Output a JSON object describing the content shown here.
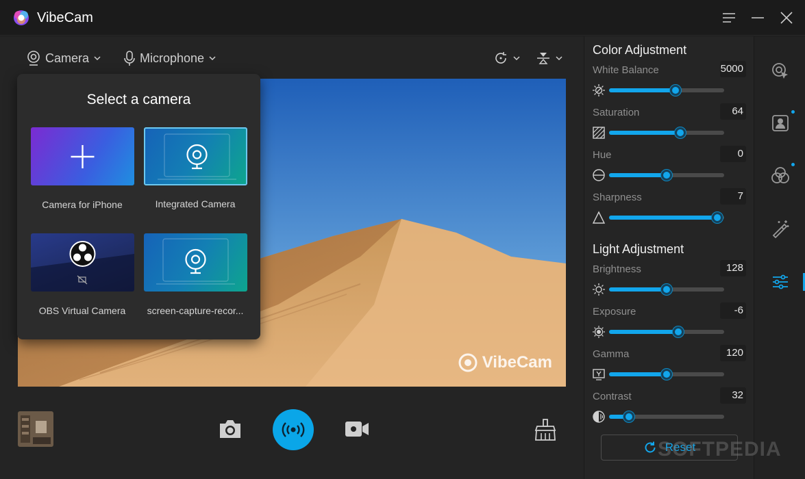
{
  "app": {
    "title": "VibeCam"
  },
  "toolbar": {
    "camera_label": "Camera",
    "microphone_label": "Microphone"
  },
  "popup": {
    "title": "Select a camera",
    "cameras": [
      {
        "label": "Camera for iPhone"
      },
      {
        "label": "Integrated Camera"
      },
      {
        "label": "OBS Virtual Camera"
      },
      {
        "label": "screen-capture-recor..."
      }
    ]
  },
  "preview": {
    "watermark": "VibeCam"
  },
  "color_adjustment": {
    "title": "Color Adjustment",
    "items": [
      {
        "label": "White Balance",
        "value": "5000",
        "level": 0.58
      },
      {
        "label": "Saturation",
        "value": "64",
        "level": 0.62
      },
      {
        "label": "Hue",
        "value": "0",
        "level": 0.5
      },
      {
        "label": "Sharpness",
        "value": "7",
        "level": 0.94
      }
    ]
  },
  "light_adjustment": {
    "title": "Light Adjustment",
    "items": [
      {
        "label": "Brightness",
        "value": "128",
        "level": 0.5
      },
      {
        "label": "Exposure",
        "value": "-6",
        "level": 0.6
      },
      {
        "label": "Gamma",
        "value": "120",
        "level": 0.5
      },
      {
        "label": "Contrast",
        "value": "32",
        "level": 0.17
      }
    ]
  },
  "reset_label": "Reset",
  "softpedia": "SOFTPEDIA",
  "colors": {
    "accent": "#12a6ec",
    "background": "#1b1b1b",
    "panel": "#252525"
  },
  "icons": [
    "app-logo-icon",
    "menu-icon",
    "minimize-icon",
    "close-icon",
    "camera-icon",
    "microphone-icon",
    "rotate-icon",
    "flip-icon",
    "snapshot-icon",
    "live-broadcast-icon",
    "record-video-icon",
    "clean-icon",
    "cursor-effect-icon",
    "portrait-icon",
    "filters-icon",
    "magic-wand-icon",
    "adjust-sliders-icon"
  ]
}
